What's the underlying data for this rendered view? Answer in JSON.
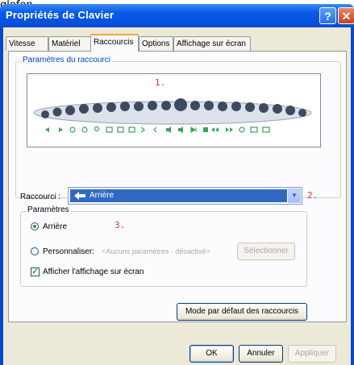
{
  "caption": "glefen.",
  "window": {
    "title": "Propriétés de Clavier",
    "help_glyph": "?",
    "close_glyph": "✕"
  },
  "tabs": [
    {
      "label": "Vitesse"
    },
    {
      "label": "Matériel"
    },
    {
      "label": "Raccourcis"
    },
    {
      "label": "Options"
    },
    {
      "label": "Affichage sur écran"
    }
  ],
  "shortcuts": {
    "group_label": "Paramètres du raccourci",
    "marker_1": "1.",
    "marker_2": "2.",
    "marker_3": "3.",
    "shortcut_label": "Raccourci :",
    "shortcut_value": "Arrière",
    "combo_arrow": "▼",
    "params_group_label": "Paramètres",
    "radio_back": "Arrière",
    "radio_custom": "Personnaliser:",
    "custom_placeholder": "<Aucuns paramètres - désactivé>",
    "select_button": "Sélectionner",
    "show_onscreen_checkbox": "Afficher l'affichage sur écran",
    "show_onscreen_checked": true,
    "radio_selected": "Arrière",
    "default_button": "Mode par défaut des raccourcis"
  },
  "footer": {
    "ok": "OK",
    "cancel": "Annuler",
    "apply": "Appliquer"
  },
  "colors": {
    "titlebar": "#0a5ce8",
    "selection": "#316ac5",
    "key_dark": "#3d4a60",
    "icon_green": "#3aa25a",
    "marker_red": "#e03030"
  }
}
